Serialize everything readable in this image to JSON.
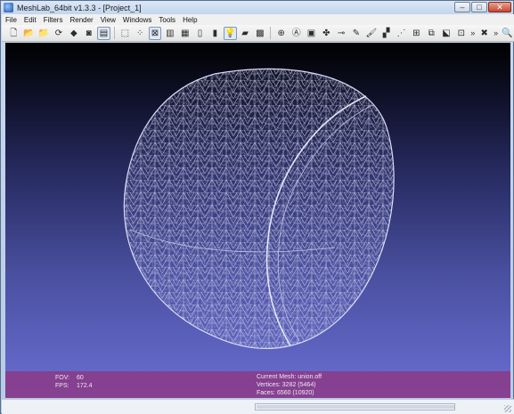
{
  "window": {
    "title": "MeshLab_64bit v1.3.3 - [Project_1]"
  },
  "window_buttons": {
    "minimize": "–",
    "maximize": "□",
    "close": "✕"
  },
  "menu": {
    "items": [
      "File",
      "Edit",
      "Filters",
      "Render",
      "View",
      "Windows",
      "Tools",
      "Help"
    ]
  },
  "toolbar": {
    "buttons": [
      {
        "name": "new-project-icon",
        "glyph": "🗋"
      },
      {
        "name": "open-project-icon",
        "glyph": "📂"
      },
      {
        "name": "import-mesh-icon",
        "glyph": "📁"
      },
      {
        "name": "reload-icon",
        "glyph": "⟳"
      },
      {
        "name": "export-mesh-icon",
        "glyph": "◆"
      },
      {
        "name": "snapshot-icon",
        "glyph": "◙"
      },
      {
        "name": "layers-icon",
        "glyph": "▤"
      },
      {
        "name": "bbox-icon",
        "glyph": "⬚"
      },
      {
        "name": "points-icon",
        "glyph": "⁘"
      },
      {
        "name": "wireframe-icon",
        "glyph": "⊠"
      },
      {
        "name": "hidden-lines-icon",
        "glyph": "▥"
      },
      {
        "name": "flat-lines-icon",
        "glyph": "▦"
      },
      {
        "name": "flat-icon",
        "glyph": "▯"
      },
      {
        "name": "smooth-icon",
        "glyph": "▮"
      },
      {
        "name": "light-bulb-icon",
        "glyph": "💡"
      },
      {
        "name": "color-icon",
        "glyph": "▰"
      },
      {
        "name": "texture-icon",
        "glyph": "▩"
      },
      {
        "name": "select-faces-icon",
        "glyph": "⊕"
      },
      {
        "name": "annotation-icon",
        "glyph": "Ⓐ"
      },
      {
        "name": "raster-icon",
        "glyph": "▣"
      },
      {
        "name": "align-icon",
        "glyph": "✤"
      },
      {
        "name": "measure-icon",
        "glyph": "⊸"
      },
      {
        "name": "paint-icon",
        "glyph": "✎"
      },
      {
        "name": "brush-icon",
        "glyph": "🖌"
      },
      {
        "name": "z-paint-icon",
        "glyph": "▞"
      },
      {
        "name": "select-vertices-icon",
        "glyph": "⋰"
      },
      {
        "name": "edit-icon",
        "glyph": "⊞"
      },
      {
        "name": "manipulator-icon",
        "glyph": "⧉"
      },
      {
        "name": "rainbow-icon",
        "glyph": "⬕"
      },
      {
        "name": "pickpoints-icon",
        "glyph": "⊡"
      },
      {
        "name": "delete-icon",
        "glyph": "✖"
      },
      {
        "name": "search-icon",
        "glyph": "🔍"
      }
    ],
    "overflow": "»"
  },
  "viewport": {
    "info_left": [
      {
        "label": "FOV:",
        "value": "60"
      },
      {
        "label": "FPS:",
        "value": "172.4"
      }
    ],
    "info_right": [
      "Current Mesh: union.off",
      "Vertices: 3282 (5464)",
      "Faces: 6560 (10920)"
    ]
  },
  "colors": {
    "background_top": "#000000",
    "background_bottom": "#6a6fd4",
    "info_bar": "#8c3782",
    "wireframe": "#c8cbe8"
  }
}
